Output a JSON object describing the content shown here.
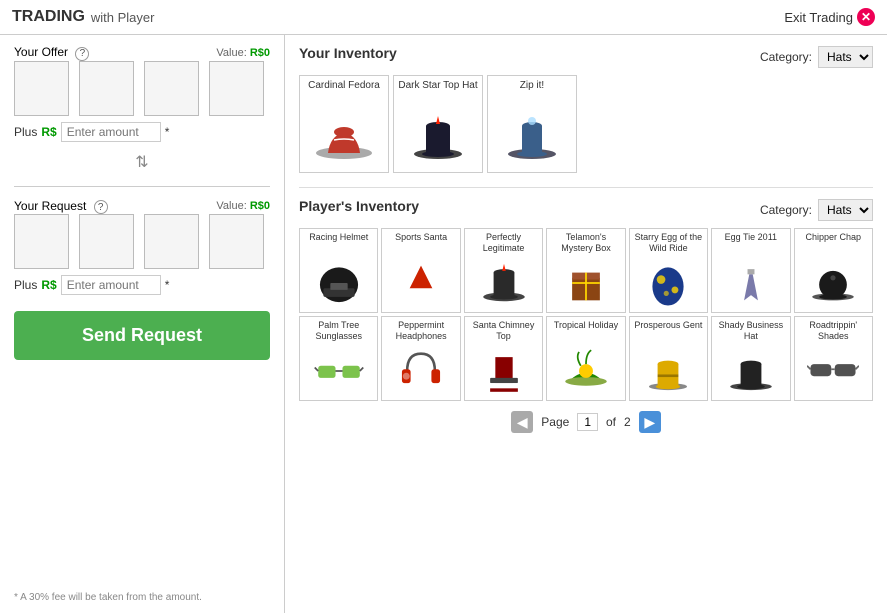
{
  "header": {
    "title": "TRADING",
    "subtitle": "with Player",
    "exit_label": "Exit Trading"
  },
  "left": {
    "offer_title": "Your Offer",
    "offer_value_label": "Value:",
    "offer_value": "R$0",
    "request_title": "Your Request",
    "request_value_label": "Value:",
    "request_value": "R$0",
    "plus_label": "Plus",
    "robux_symbol": "R$",
    "amount_placeholder": "Enter amount",
    "send_label": "Send Request",
    "fee_note": "* A 30% fee will be taken from the amount."
  },
  "your_inventory": {
    "title": "Your Inventory",
    "category_label": "Category:",
    "category_value": "Hats",
    "items": [
      {
        "name": "Cardinal Fedora",
        "color": "#c0392b",
        "shape": "fedora"
      },
      {
        "name": "Dark Star Top Hat",
        "color": "#1a1a2e",
        "shape": "tophat"
      },
      {
        "name": "Zip it!",
        "color": "#3a5f8a",
        "shape": "tophat2"
      }
    ]
  },
  "player_inventory": {
    "title": "Player's Inventory",
    "category_label": "Category:",
    "category_value": "Hats",
    "page_label": "Page",
    "page_current": "1",
    "page_of": "of",
    "page_total": "2",
    "items": [
      {
        "name": "Racing Helmet",
        "color": "#1a1a1a",
        "shape": "helmet"
      },
      {
        "name": "Sports Santa",
        "color": "#cc2200",
        "shape": "santa"
      },
      {
        "name": "Perfectly Legitimate",
        "color": "#2a2a2a",
        "shape": "tophat"
      },
      {
        "name": "Telamon's Mystery Box",
        "color": "#8B4513",
        "shape": "box"
      },
      {
        "name": "Starry Egg of the Wild Ride",
        "color": "#1a3a8a",
        "shape": "egg"
      },
      {
        "name": "Egg Tie 2011",
        "color": "#7a7aaa",
        "shape": "tie"
      },
      {
        "name": "Chipper Chap",
        "color": "#1a1a1a",
        "shape": "bowler"
      },
      {
        "name": "Palm Tree Sunglasses",
        "color": "#44aa00",
        "shape": "glasses"
      },
      {
        "name": "Peppermint Headphones",
        "color": "#cc2200",
        "shape": "headphones"
      },
      {
        "name": "Santa Chimney Top",
        "color": "#880000",
        "shape": "chimney"
      },
      {
        "name": "Tropical Holiday",
        "color": "#228800",
        "shape": "tropical"
      },
      {
        "name": "Prosperous Gent",
        "color": "#ddaa00",
        "shape": "gent"
      },
      {
        "name": "Shady Business Hat",
        "color": "#222222",
        "shape": "shady"
      },
      {
        "name": "Roadtrippin' Shades",
        "color": "#333333",
        "shape": "shades"
      }
    ]
  }
}
